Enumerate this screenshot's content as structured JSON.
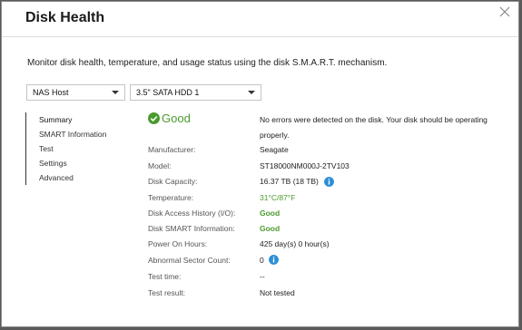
{
  "dialog": {
    "title": "Disk Health",
    "description": "Monitor disk health, temperature, and usage status using the disk S.M.A.R.T. mechanism."
  },
  "selectors": {
    "host": "NAS Host",
    "disk": "3.5\" SATA HDD 1"
  },
  "nav": {
    "items": [
      "Summary",
      "SMART Information",
      "Test",
      "Settings",
      "Advanced"
    ],
    "active": "Summary"
  },
  "summary": {
    "status": "Good",
    "status_message": "No errors were detected on the disk. Your disk should be operating properly.",
    "rows": {
      "manufacturer": {
        "label": "Manufacturer:",
        "value": "Seagate"
      },
      "model": {
        "label": "Model:",
        "value": "ST18000NM000J-2TV103"
      },
      "capacity": {
        "label": "Disk Capacity:",
        "value": "16.37 TB (18 TB)"
      },
      "temperature": {
        "label": "Temperature:",
        "value": "31°C/87°F"
      },
      "access_history": {
        "label": "Disk Access History (I/O):",
        "value": "Good"
      },
      "smart_info": {
        "label": "Disk SMART Information:",
        "value": "Good"
      },
      "power_on_hours": {
        "label": "Power On Hours:",
        "value": "425 day(s) 0 hour(s)"
      },
      "abnormal_sectors": {
        "label": "Abnormal Sector Count:",
        "value": "0"
      },
      "test_time": {
        "label": "Test time:",
        "value": "--"
      },
      "test_result": {
        "label": "Test result:",
        "value": "Not tested"
      }
    }
  },
  "colors": {
    "good": "#4a9a2e",
    "info": "#2b8fd6"
  }
}
